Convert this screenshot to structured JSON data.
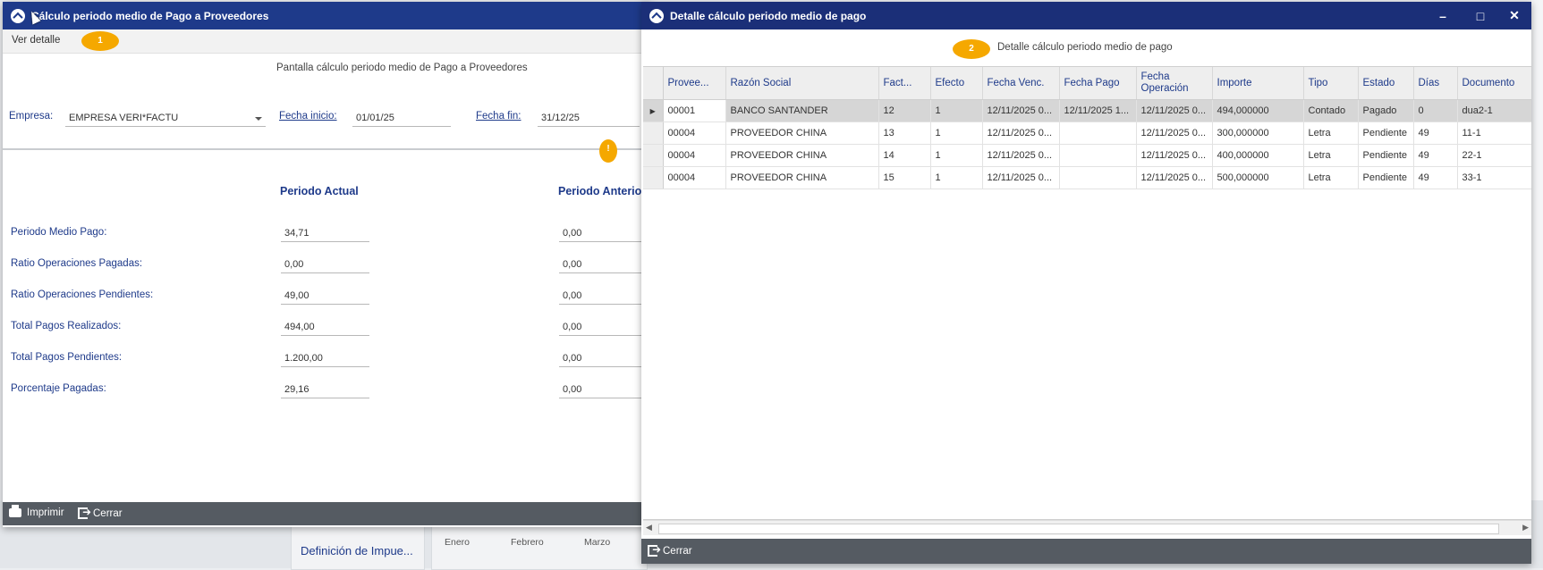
{
  "background": {
    "tile_label": "Definición de Impue...",
    "months": [
      "Enero",
      "Febrero",
      "Marzo"
    ]
  },
  "main_window": {
    "title": "Cálculo periodo medio de Pago a Proveedores",
    "menu": {
      "ver_detalle": "Ver detalle"
    },
    "badge_1": "1",
    "warning_badge": "!",
    "subtitle": "Pantalla cálculo periodo medio de Pago a Proveedores",
    "empresa": {
      "label": "Empresa:",
      "value": "EMPRESA VERI*FACTU"
    },
    "fecha_inicio": {
      "label": "Fecha inicio:",
      "value": "01/01/25"
    },
    "fecha_fin": {
      "label": "Fecha fin:",
      "value": "31/12/25"
    },
    "col_actual": "Periodo Actual",
    "col_anterior": "Periodo Anterior",
    "rows": [
      {
        "label": "Periodo Medio Pago:",
        "actual": "34,71",
        "anterior": "0,00"
      },
      {
        "label": "Ratio Operaciones Pagadas:",
        "actual": "0,00",
        "anterior": "0,00"
      },
      {
        "label": "Ratio Operaciones Pendientes:",
        "actual": "49,00",
        "anterior": "0,00"
      },
      {
        "label": "Total Pagos Realizados:",
        "actual": "494,00",
        "anterior": "0,00"
      },
      {
        "label": "Total Pagos Pendientes:",
        "actual": "1.200,00",
        "anterior": "0,00"
      },
      {
        "label": "Porcentaje Pagadas:",
        "actual": "29,16",
        "anterior": "0,00"
      }
    ],
    "footer": {
      "imprimir": "Imprimir",
      "cerrar": "Cerrar"
    }
  },
  "detail_window": {
    "title": "Detalle cálculo periodo medio de pago",
    "badge_2": "2",
    "subtitle": "Detalle cálculo periodo medio de pago",
    "controls": {
      "minimize": "–",
      "maximize": "□",
      "close": "✕"
    },
    "columns": [
      "Provee...",
      "Razón Social",
      "Fact...",
      "Efecto",
      "Fecha Venc.",
      "Fecha Pago",
      "Fecha Operación",
      "Importe",
      "Tipo",
      "Estado",
      "Días",
      "Documento"
    ],
    "rows": [
      [
        "00001",
        "BANCO SANTANDER",
        "12",
        "1",
        "12/11/2025 0...",
        "12/11/2025 1...",
        "12/11/2025 0...",
        "494,000000",
        "Contado",
        "Pagado",
        "0",
        "dua2-1"
      ],
      [
        "00004",
        "PROVEEDOR CHINA",
        "13",
        "1",
        "12/11/2025 0...",
        "",
        "12/11/2025 0...",
        "300,000000",
        "Letra",
        "Pendiente",
        "49",
        "11-1"
      ],
      [
        "00004",
        "PROVEEDOR CHINA",
        "14",
        "1",
        "12/11/2025 0...",
        "",
        "12/11/2025 0...",
        "400,000000",
        "Letra",
        "Pendiente",
        "49",
        "22-1"
      ],
      [
        "00004",
        "PROVEEDOR CHINA",
        "15",
        "1",
        "12/11/2025 0...",
        "",
        "12/11/2025 0...",
        "500,000000",
        "Letra",
        "Pendiente",
        "49",
        "33-1"
      ]
    ],
    "footer": {
      "cerrar": "Cerrar"
    }
  },
  "colors": {
    "title_bar": "#1e3a8a",
    "footer": "#555b62",
    "badge": "#f5a800",
    "label": "#1e3a8a"
  }
}
